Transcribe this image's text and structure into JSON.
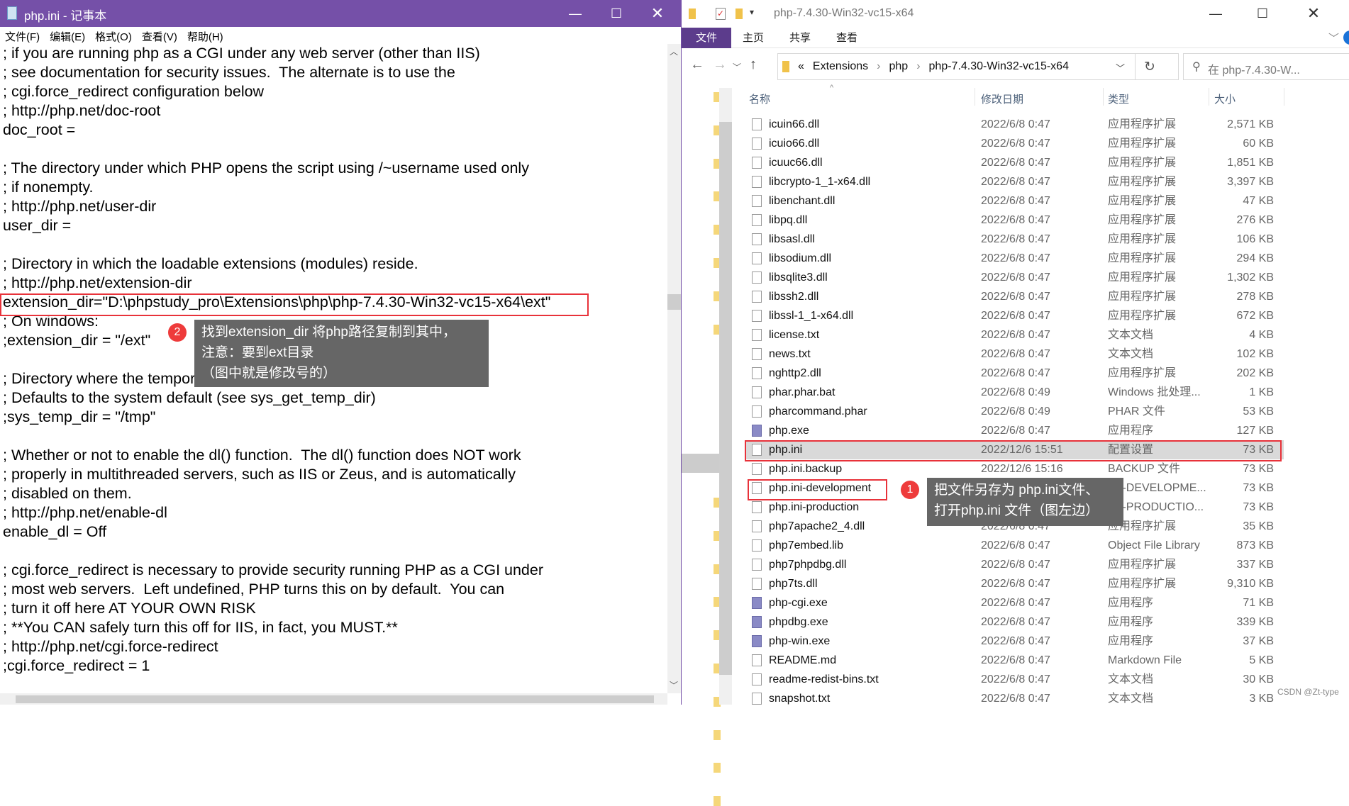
{
  "notepad": {
    "title": "php.ini - 记事本",
    "menu": [
      "文件(F)",
      "编辑(E)",
      "格式(O)",
      "查看(V)",
      "帮助(H)"
    ],
    "lines": [
      "; if you are running php as a CGI under any web server (other than IIS)",
      "; see documentation for security issues.  The alternate is to use the",
      "; cgi.force_redirect configuration below",
      "; http://php.net/doc-root",
      "doc_root =",
      "",
      "; The directory under which PHP opens the script using /~username used only",
      "; if nonempty.",
      "; http://php.net/user-dir",
      "user_dir =",
      "",
      "; Directory in which the loadable extensions (modules) reside.",
      "; http://php.net/extension-dir",
      "extension_dir=\"D:\\phpstudy_pro\\Extensions\\php\\php-7.4.30-Win32-vc15-x64\\ext\"",
      "; On windows:",
      ";extension_dir = \"/ext\"",
      "",
      "; Directory where the temporary files should be placed.",
      "; Defaults to the system default (see sys_get_temp_dir)",
      ";sys_temp_dir = \"/tmp\"",
      "",
      "; Whether or not to enable the dl() function.  The dl() function does NOT work",
      "; properly in multithreaded servers, such as IIS or Zeus, and is automatically",
      "; disabled on them.",
      "; http://php.net/enable-dl",
      "enable_dl = Off",
      "",
      "; cgi.force_redirect is necessary to provide security running PHP as a CGI under",
      "; most web servers.  Left undefined, PHP turns this on by default.  You can",
      "; turn it off here AT YOUR OWN RISK",
      "; **You CAN safely turn this off for IIS, in fact, you MUST.**",
      "; http://php.net/cgi.force-redirect",
      ";cgi.force_redirect = 1"
    ]
  },
  "annotation2": {
    "badge": "2",
    "lines": [
      "找到extension_dir 将php路径复制到其中，",
      "注意：要到ext目录",
      "（图中就是修改号的）"
    ]
  },
  "annotation1": {
    "badge": "1",
    "lines": [
      "把文件另存为 php.ini文件、",
      "打开php.ini 文件（图左边）"
    ]
  },
  "explorer": {
    "title": "php-7.4.30-Win32-vc15-x64",
    "ribbon_tabs": [
      "文件",
      "主页",
      "共享",
      "查看"
    ],
    "breadcrumb": [
      "«",
      "Extensions",
      "php",
      "php-7.4.30-Win32-vc15-x64"
    ],
    "search_placeholder": "在 php-7.4.30-W...",
    "columns": [
      "名称",
      "修改日期",
      "类型",
      "大小"
    ],
    "files": [
      [
        "icuin66.dll",
        "2022/6/8 0:47",
        "应用程序扩展",
        "2,571 KB",
        "dll"
      ],
      [
        "icuio66.dll",
        "2022/6/8 0:47",
        "应用程序扩展",
        "60 KB",
        "dll"
      ],
      [
        "icuuc66.dll",
        "2022/6/8 0:47",
        "应用程序扩展",
        "1,851 KB",
        "dll"
      ],
      [
        "libcrypto-1_1-x64.dll",
        "2022/6/8 0:47",
        "应用程序扩展",
        "3,397 KB",
        "dll"
      ],
      [
        "libenchant.dll",
        "2022/6/8 0:47",
        "应用程序扩展",
        "47 KB",
        "dll"
      ],
      [
        "libpq.dll",
        "2022/6/8 0:47",
        "应用程序扩展",
        "276 KB",
        "dll"
      ],
      [
        "libsasl.dll",
        "2022/6/8 0:47",
        "应用程序扩展",
        "106 KB",
        "dll"
      ],
      [
        "libsodium.dll",
        "2022/6/8 0:47",
        "应用程序扩展",
        "294 KB",
        "dll"
      ],
      [
        "libsqlite3.dll",
        "2022/6/8 0:47",
        "应用程序扩展",
        "1,302 KB",
        "dll"
      ],
      [
        "libssh2.dll",
        "2022/6/8 0:47",
        "应用程序扩展",
        "278 KB",
        "dll"
      ],
      [
        "libssl-1_1-x64.dll",
        "2022/6/8 0:47",
        "应用程序扩展",
        "672 KB",
        "dll"
      ],
      [
        "license.txt",
        "2022/6/8 0:47",
        "文本文档",
        "4 KB",
        "txt"
      ],
      [
        "news.txt",
        "2022/6/8 0:47",
        "文本文档",
        "102 KB",
        "txt"
      ],
      [
        "nghttp2.dll",
        "2022/6/8 0:47",
        "应用程序扩展",
        "202 KB",
        "dll"
      ],
      [
        "phar.phar.bat",
        "2022/6/8 0:49",
        "Windows 批处理...",
        "1 KB",
        "bat"
      ],
      [
        "pharcommand.phar",
        "2022/6/8 0:49",
        "PHAR 文件",
        "53 KB",
        "file"
      ],
      [
        "php.exe",
        "2022/6/8 0:47",
        "应用程序",
        "127 KB",
        "php"
      ],
      [
        "php.ini",
        "2022/12/6 15:51",
        "配置设置",
        "73 KB",
        "ini"
      ],
      [
        "php.ini.backup",
        "2022/12/6 15:16",
        "BACKUP 文件",
        "73 KB",
        "file"
      ],
      [
        "php.ini-development",
        "2022/6/8 0:47",
        "INI-DEVELOPME...",
        "73 KB",
        "file"
      ],
      [
        "php.ini-production",
        "2022/6/8 0:47",
        "INI-PRODUCTIO...",
        "73 KB",
        "file"
      ],
      [
        "php7apache2_4.dll",
        "2022/6/8 0:47",
        "应用程序扩展",
        "35 KB",
        "dll"
      ],
      [
        "php7embed.lib",
        "2022/6/8 0:47",
        "Object File Library",
        "873 KB",
        "lib"
      ],
      [
        "php7phpdbg.dll",
        "2022/6/8 0:47",
        "应用程序扩展",
        "337 KB",
        "dll"
      ],
      [
        "php7ts.dll",
        "2022/6/8 0:47",
        "应用程序扩展",
        "9,310 KB",
        "dll"
      ],
      [
        "php-cgi.exe",
        "2022/6/8 0:47",
        "应用程序",
        "71 KB",
        "php"
      ],
      [
        "phpdbg.exe",
        "2022/6/8 0:47",
        "应用程序",
        "339 KB",
        "php"
      ],
      [
        "php-win.exe",
        "2022/6/8 0:47",
        "应用程序",
        "37 KB",
        "php"
      ],
      [
        "README.md",
        "2022/6/8 0:47",
        "Markdown File",
        "5 KB",
        "md"
      ],
      [
        "readme-redist-bins.txt",
        "2022/6/8 0:47",
        "文本文档",
        "30 KB",
        "txt"
      ],
      [
        "snapshot.txt",
        "2022/6/8 0:47",
        "文本文档",
        "3 KB",
        "txt"
      ]
    ],
    "selected_file": "php.ini"
  },
  "watermark": "CSDN @Zt-type",
  "colors": {
    "notepad_titlebar": "#7550a8",
    "ribbon_file_tab": "#5c3c8c",
    "highlight_box": "#e8323a",
    "tooltip": "#666666",
    "badge": "#ee3b3b"
  }
}
